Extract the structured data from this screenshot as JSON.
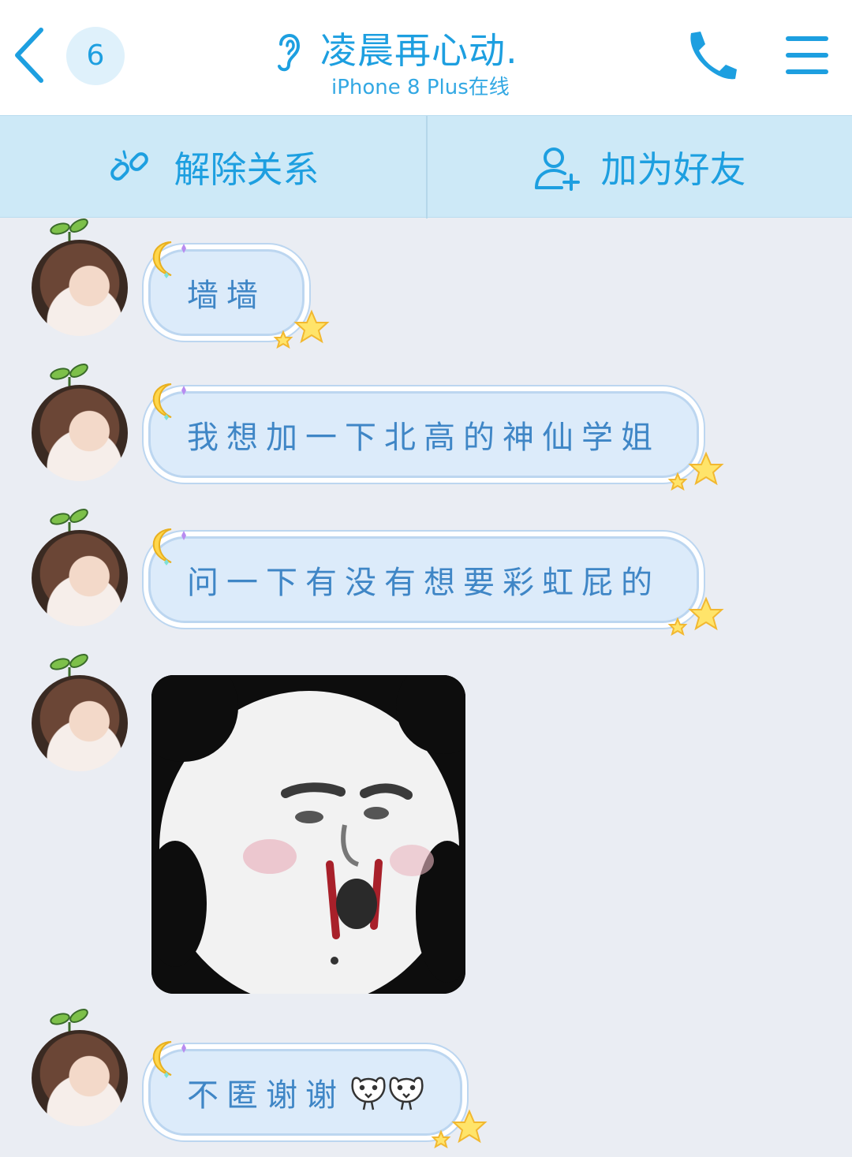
{
  "header": {
    "back_icon": "chevron-left-icon",
    "unread_count": "6",
    "title": "凌晨再心动.",
    "status": "iPhone 8 Plus在线",
    "listen_icon": "ear-icon",
    "call_icon": "phone-icon",
    "menu_icon": "menu-icon"
  },
  "actions": {
    "unlink_label": "解除关系",
    "unlink_icon": "unlink-icon",
    "add_friend_label": "加为好友",
    "add_friend_icon": "add-user-icon"
  },
  "messages": [
    {
      "type": "text",
      "text": "墙墙"
    },
    {
      "type": "text",
      "text": "我想加一下北高的神仙学姐"
    },
    {
      "type": "text",
      "text": "问一下有没有想要彩虹屁的"
    },
    {
      "type": "sticker",
      "sticker": "panda-meme-nosebleed"
    },
    {
      "type": "text",
      "text": "不匿谢谢"
    }
  ],
  "colors": {
    "accent": "#1d9fe0",
    "bubble_fill": "#dcebfa",
    "bubble_text": "#3f86c6",
    "chat_background": "#eaedf3",
    "action_bar": "#cde9f7"
  }
}
